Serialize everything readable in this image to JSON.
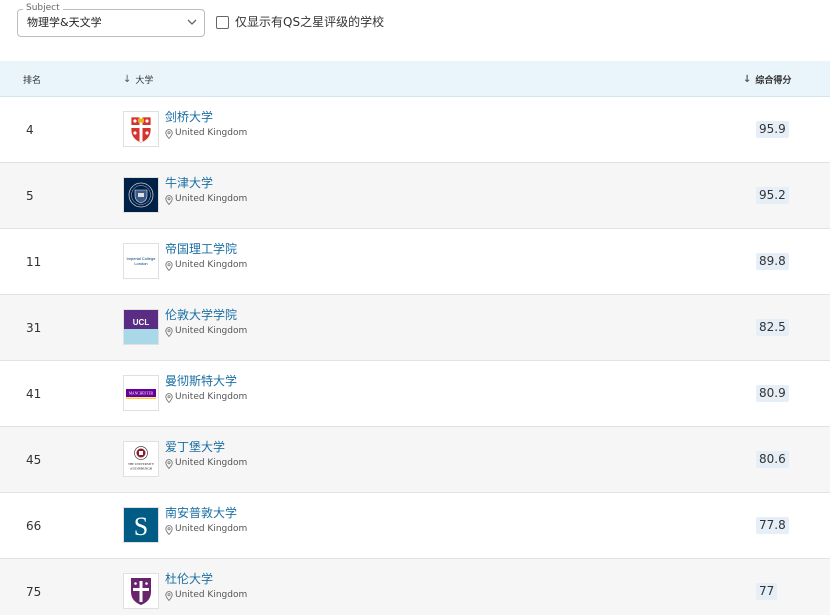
{
  "filters": {
    "subject_label": "Subject",
    "subject_value": "物理学&天文学",
    "qs_checkbox_label": "仅显示有QS之星评级的学校"
  },
  "table": {
    "headers": {
      "rank": "排名",
      "university": "大学",
      "score": "综合得分"
    },
    "rows": [
      {
        "rank": "4",
        "name": "剑桥大学",
        "location": "United Kingdom",
        "score": "95.9"
      },
      {
        "rank": "5",
        "name": "牛津大学",
        "location": "United Kingdom",
        "score": "95.2"
      },
      {
        "rank": "11",
        "name": "帝国理工学院",
        "location": "United Kingdom",
        "score": "89.8"
      },
      {
        "rank": "31",
        "name": "伦敦大学学院",
        "location": "United Kingdom",
        "score": "82.5"
      },
      {
        "rank": "41",
        "name": "曼彻斯特大学",
        "location": "United Kingdom",
        "score": "80.9"
      },
      {
        "rank": "45",
        "name": "爱丁堡大学",
        "location": "United Kingdom",
        "score": "80.6"
      },
      {
        "rank": "66",
        "name": "南安普敦大学",
        "location": "United Kingdom",
        "score": "77.8"
      },
      {
        "rank": "75",
        "name": "杜伦大学",
        "location": "United Kingdom",
        "score": "77"
      }
    ]
  },
  "logos": {
    "imperial_text": [
      "Imperial College",
      "London"
    ],
    "ucl_text": "UCL",
    "manchester_text": "MANCHESTER",
    "edinburgh_text": [
      "THE UNIVERSITY",
      "of EDINBURGH"
    ],
    "southampton_text": "S"
  },
  "colors": {
    "link": "#1a6fa3",
    "header_bg": "#eaf4fb",
    "alt_row_bg": "#f6f6f6",
    "score_bg": "#e6eff7",
    "ucl_purple": "#5b2c83",
    "manchester_purple": "#660099",
    "southampton_blue": "#005c84",
    "durham_purple": "#68246d",
    "oxford_navy": "#002147",
    "cambridge_red": "#d6322e"
  },
  "icons": [
    "chevron-down-icon",
    "sort-arrow-icon",
    "location-pin-icon"
  ]
}
